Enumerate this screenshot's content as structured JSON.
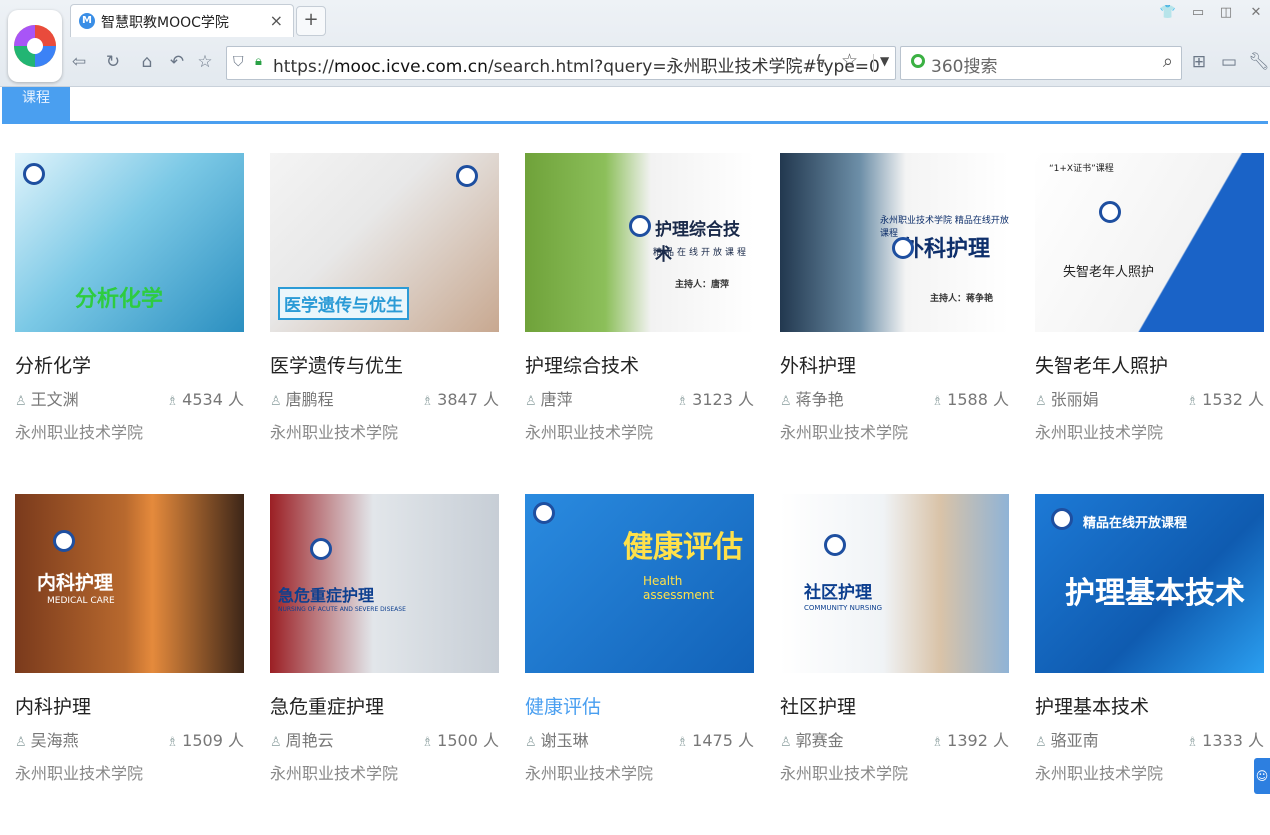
{
  "browser": {
    "tab_title": "智慧职教MOOC学院",
    "tab_favicon": "M",
    "tab_close": "×",
    "new_tab": "+",
    "url_prefix": "https://",
    "url_domain": "mooc.icve.com.cn",
    "url_path": "/search.html?query=永州职业技术学院#type=0",
    "search_engine": "360搜索",
    "icons": [
      "back-icon",
      "refresh-icon",
      "home-icon",
      "undo-icon",
      "favorite-icon",
      "shield-icon",
      "lock-icon",
      "bolt-icon",
      "star-icon",
      "dropdown-icon",
      "search-icon",
      "grid-icon",
      "battery-icon",
      "wrench-icon",
      "shirt-icon",
      "minimize-icon",
      "restore-icon",
      "close-icon"
    ]
  },
  "page": {
    "tab_label": "课程",
    "count_suffix": "人"
  },
  "courses": [
    {
      "title": "分析化学",
      "teacher": "王文渊",
      "count": "4534",
      "school": "永州职业技术学院",
      "thumb_text": "分析化学",
      "thumb_color": "#5bb6d8"
    },
    {
      "title": "医学遗传与优生",
      "teacher": "唐鹏程",
      "count": "3847",
      "school": "永州职业技术学院",
      "thumb_text": "医学遗传与优生",
      "thumb_color": "#cfd4d8"
    },
    {
      "title": "护理综合技术",
      "teacher": "唐萍",
      "count": "3123",
      "school": "永州职业技术学院",
      "thumb_text": "护理综合技术",
      "thumb_sub": "精品在线开放课程",
      "thumb_host": "主持人：唐萍",
      "thumb_college": "永州职业技术学院",
      "thumb_color": "#7fb14a"
    },
    {
      "title": "外科护理",
      "teacher": "蒋争艳",
      "count": "1588",
      "school": "永州职业技术学院",
      "thumb_text": "外科护理",
      "thumb_sub": "永州职业技术学院 精品在线开放课程",
      "thumb_host": "主持人：蒋争艳",
      "thumb_color": "#1b2a3e"
    },
    {
      "title": "失智老年人照护",
      "teacher": "张丽娟",
      "count": "1532",
      "school": "永州职业技术学院",
      "thumb_text": "失智老年人照护",
      "thumb_sub": "“1+X证书”课程",
      "thumb_color": "#1a63c7"
    },
    {
      "title": "内科护理",
      "teacher": "吴海燕",
      "count": "1509",
      "school": "永州职业技术学院",
      "thumb_text": "内科护理",
      "thumb_sub": "MEDICAL CARE",
      "thumb_color": "#8a3f1e"
    },
    {
      "title": "急危重症护理",
      "teacher": "周艳云",
      "count": "1500",
      "school": "永州职业技术学院",
      "thumb_text": "急危重症护理",
      "thumb_sub": "NURSING OF ACUTE AND SEVERE DISEASE",
      "thumb_color": "#bd2a2f"
    },
    {
      "title": "健康评估",
      "teacher": "谢玉琳",
      "count": "1475",
      "school": "永州职业技术学院",
      "thumb_text": "健康评估",
      "thumb_sub": "Health assessment",
      "thumb_color": "#1a75c9"
    },
    {
      "title": "社区护理",
      "teacher": "郭赛金",
      "count": "1392",
      "school": "永州职业技术学院",
      "thumb_text": "社区护理",
      "thumb_sub": "COMMUNITY NURSING",
      "thumb_color": "#e9edf0"
    },
    {
      "title": "护理基本技术",
      "teacher": "骆亚南",
      "count": "1333",
      "school": "永州职业技术学院",
      "thumb_text": "护理基本技术",
      "thumb_sub": "精品在线开放课程",
      "thumb_color": "#1572c6"
    }
  ]
}
